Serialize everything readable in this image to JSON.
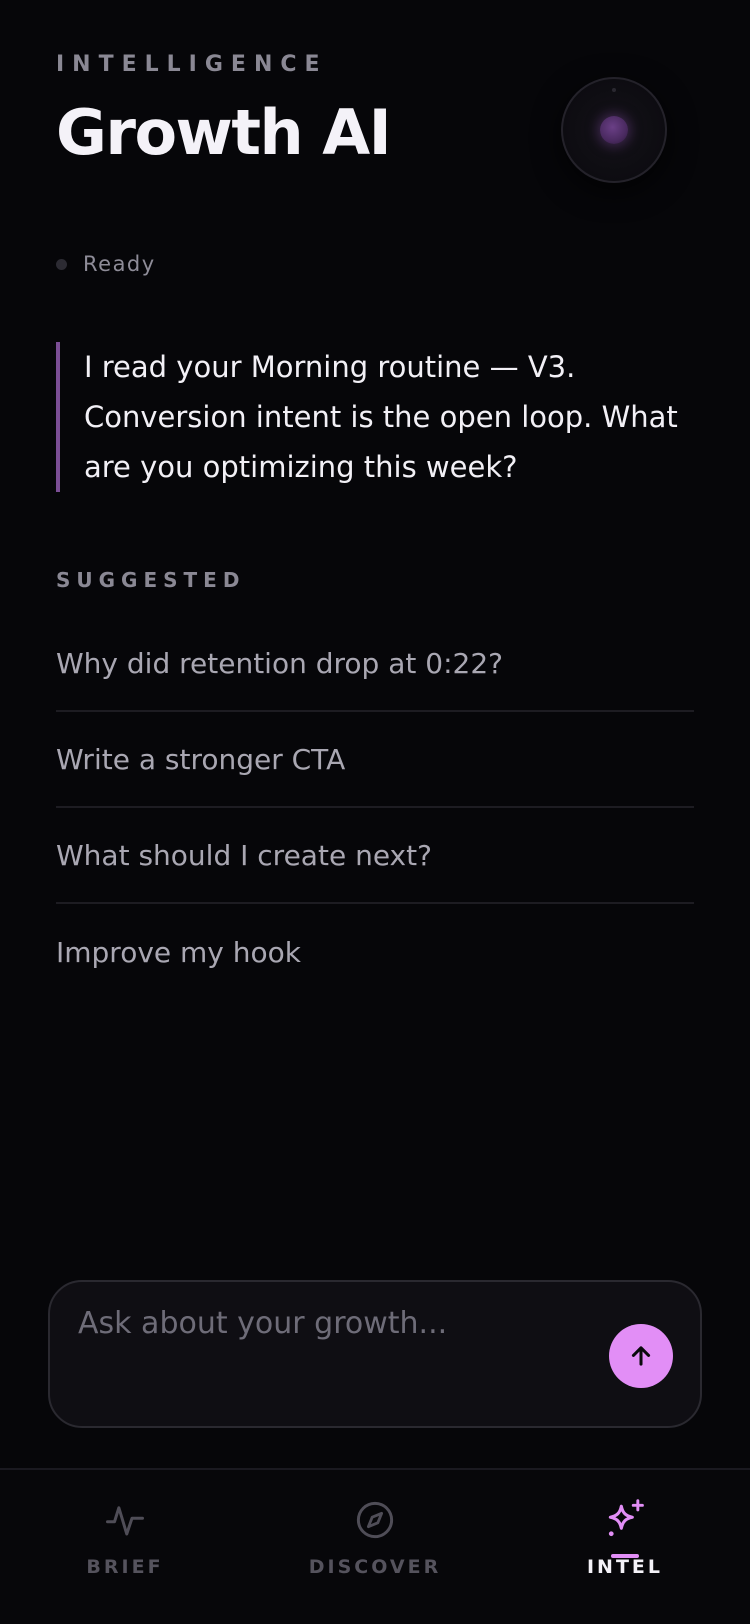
{
  "header": {
    "eyebrow": "INTELLIGENCE",
    "title": "Growth AI",
    "orb_icon": "ai-orb-icon"
  },
  "status": {
    "label": "Ready",
    "dot_color": "#2c2b33"
  },
  "assistant_message": {
    "text": "I read your Morning routine — V3. Conversion intent is the open loop. What are you optimizing this week?",
    "accent_color": "#7b4e95"
  },
  "suggested": {
    "label": "SUGGESTED",
    "items": [
      "Why did retention drop at 0:22?",
      "Write a stronger CTA",
      "What should I create next?",
      "Improve my hook"
    ]
  },
  "composer": {
    "placeholder": "Ask about your growth...",
    "value": "",
    "send_icon": "arrow-up-icon",
    "accent_color": "#e28ef6"
  },
  "tabs": [
    {
      "label": "BRIEF",
      "icon": "pulse-icon",
      "active": false
    },
    {
      "label": "DISCOVER",
      "icon": "compass-icon",
      "active": false
    },
    {
      "label": "INTEL",
      "icon": "sparkles-icon",
      "active": true
    }
  ]
}
